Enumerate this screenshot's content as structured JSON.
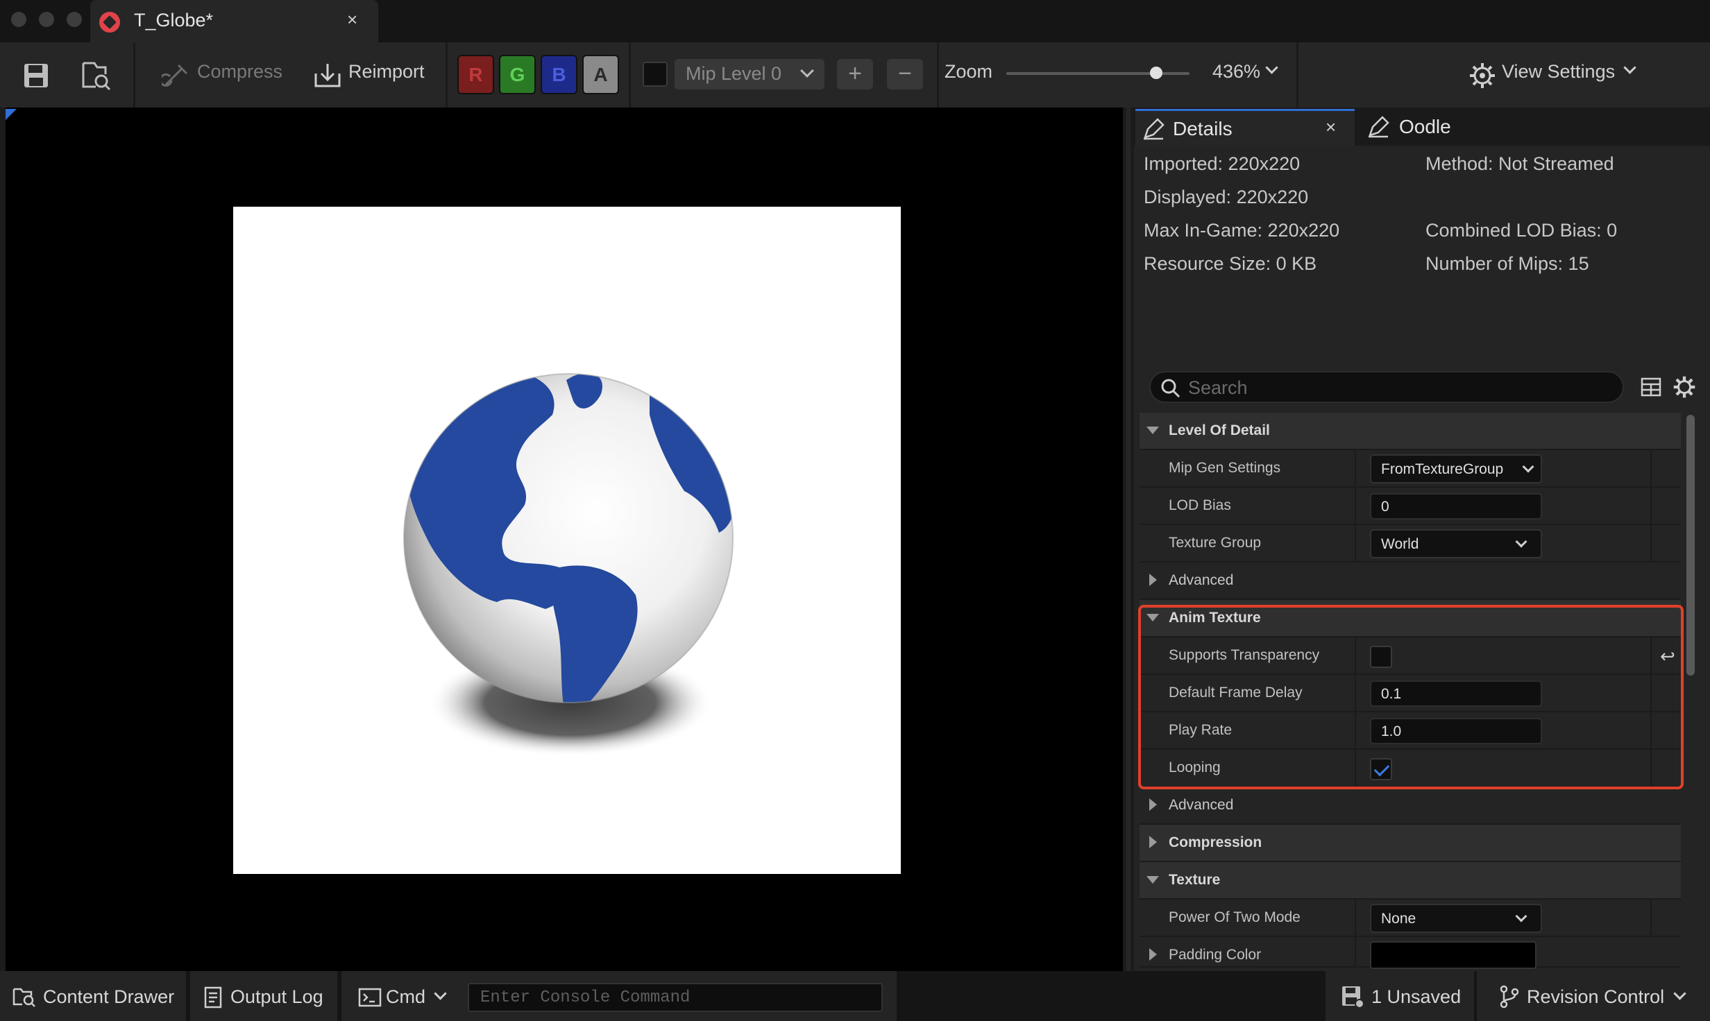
{
  "window": {
    "tab_title": "T_Globe*",
    "close_glyph": "×"
  },
  "toolbar": {
    "compress_label": "Compress",
    "reimport_label": "Reimport",
    "channels": [
      {
        "label": "R",
        "color": "#7a1e1e"
      },
      {
        "label": "G",
        "color": "#2a7a25"
      },
      {
        "label": "B",
        "color": "#1e2a8a"
      },
      {
        "label": "A",
        "color": "#8a8a8a"
      }
    ],
    "mip_level": "Mip Level 0",
    "zoom_label": "Zoom",
    "zoom_value": "436%",
    "zoom_slider_fraction": 0.82,
    "view_settings_label": "View Settings"
  },
  "details": {
    "tabs": [
      {
        "label": "Details",
        "active": true
      },
      {
        "label": "Oodle",
        "active": false
      }
    ],
    "info_left": [
      "Imported: 220x220",
      "Displayed: 220x220",
      "Max In-Game: 220x220",
      "Resource Size: 0 KB"
    ],
    "info_right": [
      "Method: Not Streamed",
      "",
      "Combined LOD Bias: 0",
      "Number of Mips: 15"
    ],
    "search_placeholder": "Search",
    "sections": {
      "level_of_detail": "Level Of Detail",
      "mip_gen_settings": {
        "label": "Mip Gen Settings",
        "value": "FromTextureGroup"
      },
      "lod_bias": {
        "label": "LOD Bias",
        "value": "0"
      },
      "texture_group": {
        "label": "Texture Group",
        "value": "World"
      },
      "advanced_1": "Advanced",
      "anim_texture": "Anim Texture",
      "supports_transparency": {
        "label": "Supports Transparency",
        "checked": false
      },
      "default_frame_delay": {
        "label": "Default Frame Delay",
        "value": "0.1"
      },
      "play_rate": {
        "label": "Play Rate",
        "value": "1.0"
      },
      "looping": {
        "label": "Looping",
        "checked": true
      },
      "advanced_2": "Advanced",
      "compression": "Compression",
      "texture": "Texture",
      "power_of_two_mode": {
        "label": "Power Of Two Mode",
        "value": "None"
      },
      "padding_color": {
        "label": "Padding Color",
        "color": "#000000"
      }
    },
    "highlight_color": "#e0402a"
  },
  "statusbar": {
    "content_drawer": "Content Drawer",
    "output_log": "Output Log",
    "cmd": "Cmd",
    "console_placeholder": "Enter Console Command",
    "unsaved": "1 Unsaved",
    "revision_control": "Revision Control"
  }
}
